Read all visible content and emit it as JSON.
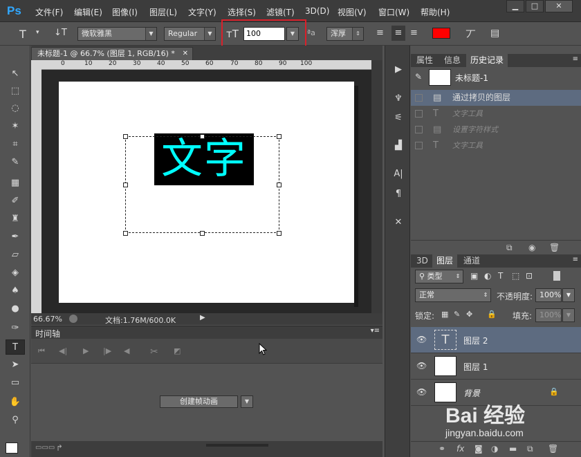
{
  "app": {
    "logo": "Ps"
  },
  "menu": [
    "文件(F)",
    "编辑(E)",
    "图像(I)",
    "图层(L)",
    "文字(Y)",
    "选择(S)",
    "滤镜(T)",
    "3D(D)",
    "视图(V)",
    "窗口(W)",
    "帮助(H)"
  ],
  "window_controls": {
    "minimize": "▁",
    "maximize": "□",
    "close": "✕"
  },
  "options": {
    "font_family": "微软雅黑",
    "font_style": "Regular",
    "font_size": "100",
    "antialias": "浑厚",
    "text_color": "#ff0000"
  },
  "document": {
    "tab_title": "未标题-1 @ 66.7% (图层 1, RGB/16) *",
    "canvas_text": "文字",
    "ruler_top": [
      "0",
      "10",
      "20",
      "30",
      "40",
      "50",
      "60",
      "70",
      "80",
      "90",
      "100"
    ],
    "zoom": "66.67%",
    "doc_info": "文档:1.76M/600.0K"
  },
  "timeline": {
    "title": "时间轴",
    "create_button": "创建帧动画"
  },
  "history_panel": {
    "tabs": [
      "属性",
      "信息",
      "历史记录"
    ],
    "active_tab": "历史记录",
    "snapshot_name": "未标题-1",
    "items": [
      {
        "label": "通过拷贝的图层",
        "state": "selected"
      },
      {
        "label": "文字工具",
        "state": "future"
      },
      {
        "label": "设置字符样式",
        "state": "future"
      },
      {
        "label": "文字工具",
        "state": "future"
      }
    ]
  },
  "layers_panel": {
    "tabs": [
      "3D",
      "图层",
      "通道"
    ],
    "active_tab": "图层",
    "filter_label": "类型",
    "blend_mode": "正常",
    "opacity_label": "不透明度:",
    "opacity_value": "100%",
    "lock_label": "锁定:",
    "fill_label": "填充:",
    "fill_value": "100%",
    "layers": [
      {
        "name": "图层 2",
        "thumb": "T",
        "selected": true,
        "locked": false
      },
      {
        "name": "图层 1",
        "thumb": "",
        "selected": false,
        "locked": false
      },
      {
        "name": "背景",
        "thumb": "",
        "selected": false,
        "locked": true
      }
    ]
  },
  "watermark": {
    "brand": "Bai 经验",
    "url": "jingyan.baidu.com"
  }
}
